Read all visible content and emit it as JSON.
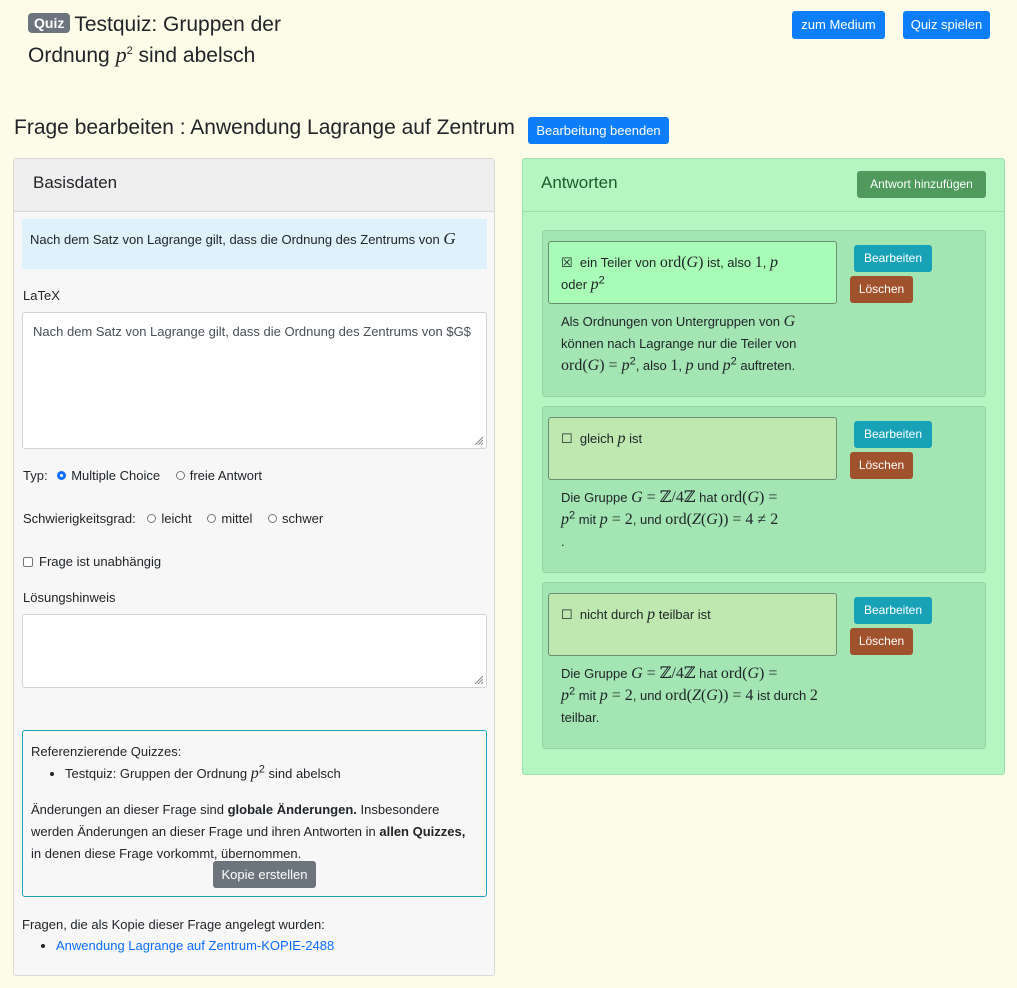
{
  "header": {
    "badge": "Quiz",
    "title_part1": "Testquiz: Gruppen der",
    "title_part2": "Ordnung",
    "title_part3": "sind abelsch",
    "medium_button": "zum Medium",
    "play_button": "Quiz spielen"
  },
  "edit": {
    "title": "Frage bearbeiten : Anwendung Lagrange auf Zentrum",
    "end_button": "Bearbeitung beenden"
  },
  "basis": {
    "heading": "Basisdaten",
    "preview_text": "Nach dem Satz von Lagrange gilt, dass die Ordnung des Zentrums von",
    "latex_label": "LaTeX",
    "latex_value": "Nach dem Satz von Lagrange gilt, dass die Ordnung des Zentrums von $G$",
    "type_label": "Typ:",
    "type_options": [
      "Multiple Choice",
      "freie Antwort"
    ],
    "type_selected": "Multiple Choice",
    "difficulty_label": "Schwierigkeitsgrad:",
    "difficulty_options": [
      "leicht",
      "mittel",
      "schwer"
    ],
    "independent_label": "Frage ist unabhängig",
    "hint_label": "Lösungshinweis",
    "hint_value": "",
    "ref_title": "Referenzierende Quizzes:",
    "ref_item_prefix": "Testquiz: Gruppen der Ordnung",
    "ref_item_suffix": "sind abelsch",
    "notice_1": "Änderungen an dieser Frage sind",
    "notice_bold_1": "globale Änderungen.",
    "notice_2": "Insbesondere werden Änderungen an dieser Frage und ihren Antworten in",
    "notice_bold_2": "allen Quizzes,",
    "notice_3": "in denen diese Frage vorkommt, übernommen.",
    "copy_button": "Kopie erstellen",
    "copies_title": "Fragen, die als Kopie dieser Frage angelegt wurden:",
    "copies_link": "Anwendung Lagrange auf Zentrum-KOPIE-2488"
  },
  "answers": {
    "heading": "Antworten",
    "add_button": "Antwort hinzufügen",
    "edit_label": "Bearbeiten",
    "delete_label": "Löschen",
    "checked_mark": "☒",
    "unchecked_mark": "☐",
    "a1_text_1": "ein Teiler von",
    "a1_text_2": "ist, also",
    "a1_text_3": "oder",
    "a1_expl_1": "Als Ordnungen von Untergruppen von",
    "a1_expl_2": "können nach Lagrange nur die Teiler von",
    "a1_expl_3": ", also",
    "a1_expl_4": "und",
    "a1_expl_5": "auftreten.",
    "a2_text_1": "gleich",
    "a2_text_2": "ist",
    "a2_expl_1": "Die Gruppe",
    "a2_expl_2": "hat",
    "a2_expl_3": "mit",
    "a2_expl_4": ", und",
    "a2_expl_5": ".",
    "a3_text_1": "nicht durch",
    "a3_text_2": "teilbar ist",
    "a3_expl_5": "ist durch",
    "a3_expl_6": "teilbar."
  },
  "colors": {
    "page_bg": "#fcfce8",
    "primary": "#0d7ef8",
    "teal": "#17a2b8",
    "brown": "#a0522d",
    "answers_bg": "#b5f5c2",
    "correct_answer_bg": "#a9fcb7"
  }
}
